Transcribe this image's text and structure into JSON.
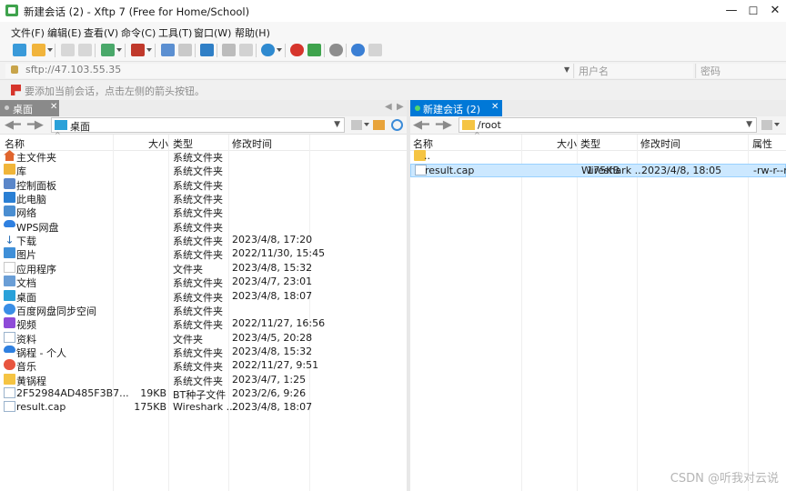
{
  "window": {
    "title": "新建会话 (2)  - Xftp 7 (Free for Home/School)",
    "minimize": "—",
    "maximize": "☐",
    "close": "✕"
  },
  "menu": [
    "文件(F)",
    "编辑(E)",
    "查看(V)",
    "命令(C)",
    "工具(T)",
    "窗口(W)",
    "帮助(H)"
  ],
  "address": {
    "host_value": "sftp://47.103.55.35",
    "username_placeholder": "用户名",
    "password_placeholder": "密码"
  },
  "hint": "要添加当前会话，点击左侧的箭头按钮。",
  "tabs": {
    "local": "桌面",
    "remote": "新建会话 (2)"
  },
  "local": {
    "path": "桌面",
    "columns": [
      "名称",
      "大小",
      "类型",
      "修改时间"
    ],
    "rows": [
      {
        "name": "主文件夹",
        "size": "",
        "type": "系统文件夹",
        "mtime": "",
        "icon": "home-icon"
      },
      {
        "name": "库",
        "size": "",
        "type": "系统文件夹",
        "mtime": "",
        "icon": "library-icon"
      },
      {
        "name": "控制面板",
        "size": "",
        "type": "系统文件夹",
        "mtime": "",
        "icon": "control-panel-icon"
      },
      {
        "name": "此电脑",
        "size": "",
        "type": "系统文件夹",
        "mtime": "",
        "icon": "computer-icon"
      },
      {
        "name": "网络",
        "size": "",
        "type": "系统文件夹",
        "mtime": "",
        "icon": "network-icon"
      },
      {
        "name": "WPS网盘",
        "size": "",
        "type": "系统文件夹",
        "mtime": "",
        "icon": "cloud-icon"
      },
      {
        "name": "下载",
        "size": "",
        "type": "系统文件夹",
        "mtime": "2023/4/8, 17:20",
        "icon": "download-icon"
      },
      {
        "name": "图片",
        "size": "",
        "type": "系统文件夹",
        "mtime": "2022/11/30, 15:45",
        "icon": "pictures-icon"
      },
      {
        "name": "应用程序",
        "size": "",
        "type": "文件夹",
        "mtime": "2023/4/8, 15:32",
        "icon": "blank-folder-icon"
      },
      {
        "name": "文档",
        "size": "",
        "type": "系统文件夹",
        "mtime": "2023/4/7, 23:01",
        "icon": "documents-icon"
      },
      {
        "name": "桌面",
        "size": "",
        "type": "系统文件夹",
        "mtime": "2023/4/8, 18:07",
        "icon": "desktop-icon"
      },
      {
        "name": "百度网盘同步空间",
        "size": "",
        "type": "系统文件夹",
        "mtime": "",
        "icon": "baidu-cloud-icon"
      },
      {
        "name": "视频",
        "size": "",
        "type": "系统文件夹",
        "mtime": "2022/11/27, 16:56",
        "icon": "videos-icon"
      },
      {
        "name": "资料",
        "size": "",
        "type": "文件夹",
        "mtime": "2023/4/5, 20:28",
        "icon": "file-folder-icon"
      },
      {
        "name": "锅程 - 个人",
        "size": "",
        "type": "系统文件夹",
        "mtime": "2023/4/8, 15:32",
        "icon": "onedrive-icon"
      },
      {
        "name": "音乐",
        "size": "",
        "type": "系统文件夹",
        "mtime": "2022/11/27, 9:51",
        "icon": "music-icon"
      },
      {
        "name": "黄锅程",
        "size": "",
        "type": "系统文件夹",
        "mtime": "2023/4/7, 1:25",
        "icon": "user-folder-icon"
      },
      {
        "name": "2F52984AD485F3B7...",
        "size": "19KB",
        "type": "BT种子文件",
        "mtime": "2023/2/6, 9:26",
        "icon": "torrent-file-icon"
      },
      {
        "name": "result.cap",
        "size": "175KB",
        "type": "Wireshark ...",
        "mtime": "2023/4/8, 18:07",
        "icon": "capture-file-icon"
      }
    ]
  },
  "remote": {
    "path": "/root",
    "columns": [
      "名称",
      "大小",
      "类型",
      "修改时间",
      "属性"
    ],
    "rows": [
      {
        "name": "..",
        "size": "",
        "type": "",
        "mtime": "",
        "attr": "",
        "icon": "parent-folder-icon"
      },
      {
        "name": "result.cap",
        "size": "175KB",
        "type": "Wireshark ...",
        "mtime": "2023/4/8, 18:05",
        "attr": "-rw-r--r",
        "icon": "capture-file-icon"
      }
    ]
  },
  "watermark": "CSDN @听我对云说"
}
